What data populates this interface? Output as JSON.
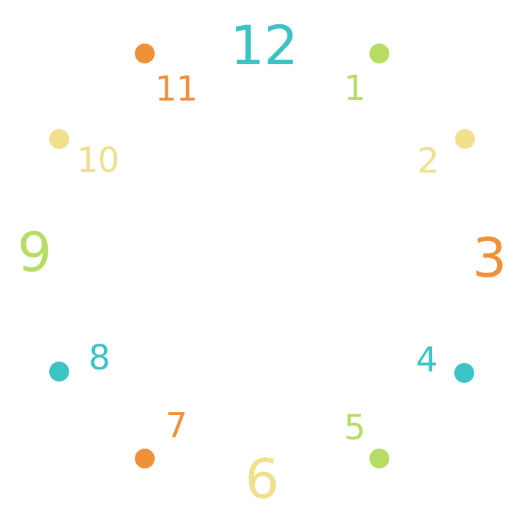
{
  "colors": {
    "teal": "#3cc3c4",
    "green": "#b6dc64",
    "yellow": "#f0df8c",
    "orange": "#f0913a"
  },
  "numerals": {
    "n12": "12",
    "n1": "1",
    "n2": "2",
    "n3": "3",
    "n4": "4",
    "n5": "5",
    "n6": "6",
    "n7": "7",
    "n8": "8",
    "n9": "9",
    "n10": "10",
    "n11": "11"
  },
  "numeral_colors": {
    "n12": "teal",
    "n1": "green",
    "n2": "yellow",
    "n3": "orange",
    "n4": "teal",
    "n5": "green",
    "n6": "yellow",
    "n7": "orange",
    "n8": "teal",
    "n9": "green",
    "n10": "yellow",
    "n11": "orange"
  },
  "dot_colors": {
    "d1": "green",
    "d2": "yellow",
    "d4": "teal",
    "d5": "green",
    "d7": "orange",
    "d8": "teal",
    "d10": "yellow",
    "d11": "orange"
  }
}
